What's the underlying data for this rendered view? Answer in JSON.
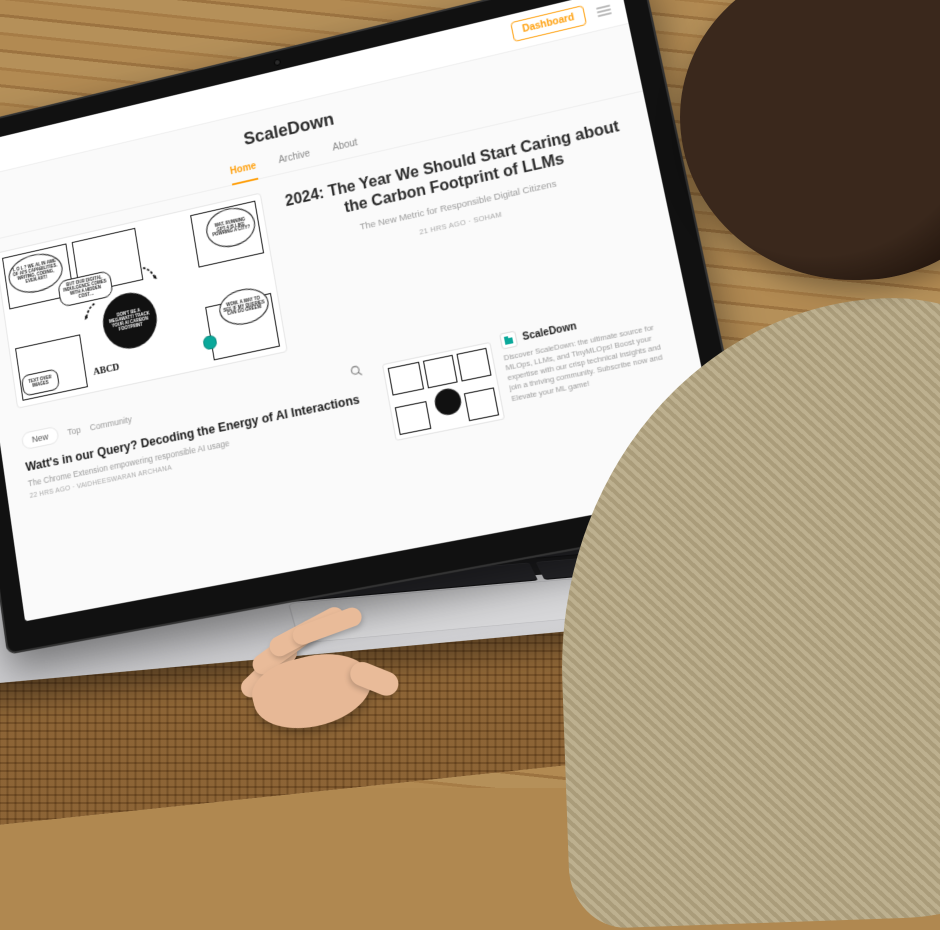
{
  "header": {
    "dashboard_label": "Dashboard"
  },
  "brand": {
    "title": "ScaleDown"
  },
  "tabs": {
    "home": "Home",
    "archive": "Archive",
    "about": "About",
    "active": "home"
  },
  "featured": {
    "title": "2024: The Year We Should Start Caring about the Carbon Footprint of LLMs",
    "subtitle": "The New Metric for Responsible Digital Citizens",
    "meta": "21 HRS AGO · SOHAM",
    "comic": {
      "bubble_awe": "L O L ?  WE AL IN AWE OF AI'S CAPABILITIES. WRITING, CODING, EVEN ART!",
      "bubble_hidden": "BUT OUR DIGITAL INDULGENCE COMES WITH A HIDDEN COST…",
      "bubble_gpt4": "WAT. RUNNING GPT-4 IS LIKE POWRING A CITY?",
      "bubble_green": "WOW. A WAY TO SEE IF MY QUERIES CAN GO GREEN!",
      "black_circle": "DON'T BE A MEGAWATT! TRACK YOUR AI CARBON FOOTPRINT",
      "textover": "TEXT OVER IMAGES",
      "abcd": "ABCD"
    }
  },
  "filters": {
    "new": "New",
    "top": "Top",
    "community": "Community"
  },
  "article2": {
    "title": "Watt's in our Query? Decoding the Energy of AI Interactions",
    "subtitle": "The Chrome Extension empowering responsible AI usage",
    "meta": "22 HRS AGO · VAIDHEESWARAN ARCHANA"
  },
  "about": {
    "name": "ScaleDown",
    "desc": "Discover ScaleDown: the ultimate source for MLOps, LLMs, and TinyMLOps! Boost your expertise with our crisp technical insights and join a thriving community. Subscribe now and Elevate your ML game!"
  }
}
